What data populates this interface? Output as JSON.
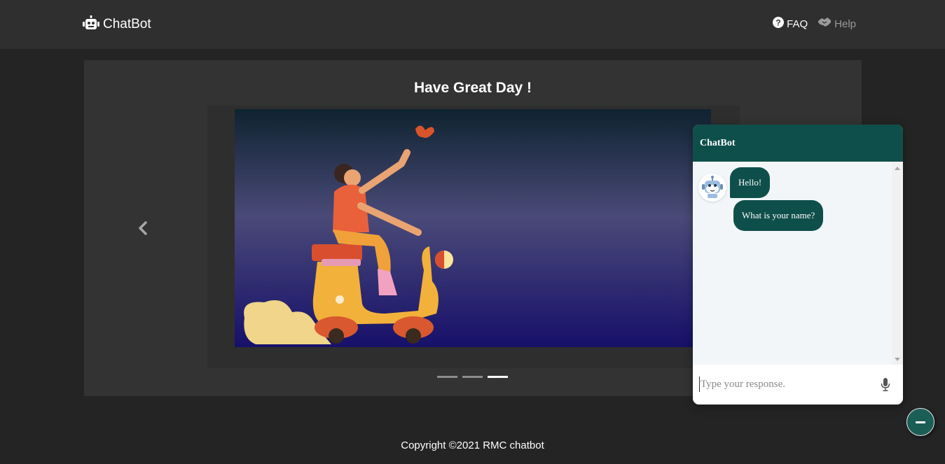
{
  "navbar": {
    "brand": "ChatBot",
    "brand_icon": "robot-icon",
    "links": [
      {
        "label": "FAQ",
        "icon": "question-circle-icon"
      },
      {
        "label": "Help",
        "icon": "handshake-icon"
      }
    ]
  },
  "carousel": {
    "title": "Have Great Day !",
    "slide_image": "person-riding-scooter-illustration",
    "prev_icon": "chevron-left-icon",
    "indicator_count": 3,
    "active_indicator": 3
  },
  "chat": {
    "header_title": "ChatBot",
    "messages": [
      {
        "from": "bot",
        "text": "Hello!"
      },
      {
        "from": "bot",
        "text": "What is your name?"
      }
    ],
    "input_placeholder": "Type your response.",
    "mic_icon": "microphone-icon",
    "minimize_icon": "minus-icon"
  },
  "footer": {
    "copyright": "Copyright ©2021 RMC chatbot"
  },
  "colors": {
    "page_bg": "#242424",
    "navbar_bg": "#2f2f2f",
    "panel_bg": "#333333",
    "chat_accent": "#0f4f4b"
  }
}
